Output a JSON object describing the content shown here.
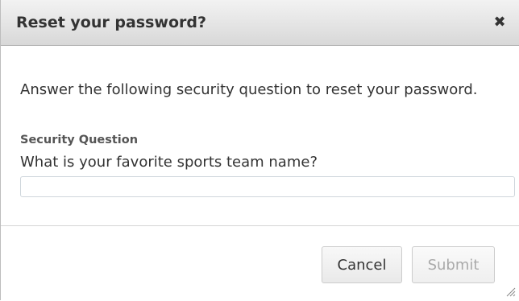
{
  "dialog": {
    "title": "Reset your password?",
    "close_glyph": "✖",
    "close_icon": "close-icon"
  },
  "body": {
    "instructions": "Answer the following security question to reset your password.",
    "question_label": "Security Question",
    "question_text": "What is your favorite sports team name?",
    "answer": {
      "value": "",
      "placeholder": ""
    }
  },
  "footer": {
    "cancel_label": "Cancel",
    "submit_label": "Submit",
    "submit_disabled": true
  },
  "colors": {
    "title_text": "#333333",
    "label_text": "#555555",
    "disabled_text": "#a9a9a9",
    "titlebar_bg": "#e4e4e4"
  }
}
